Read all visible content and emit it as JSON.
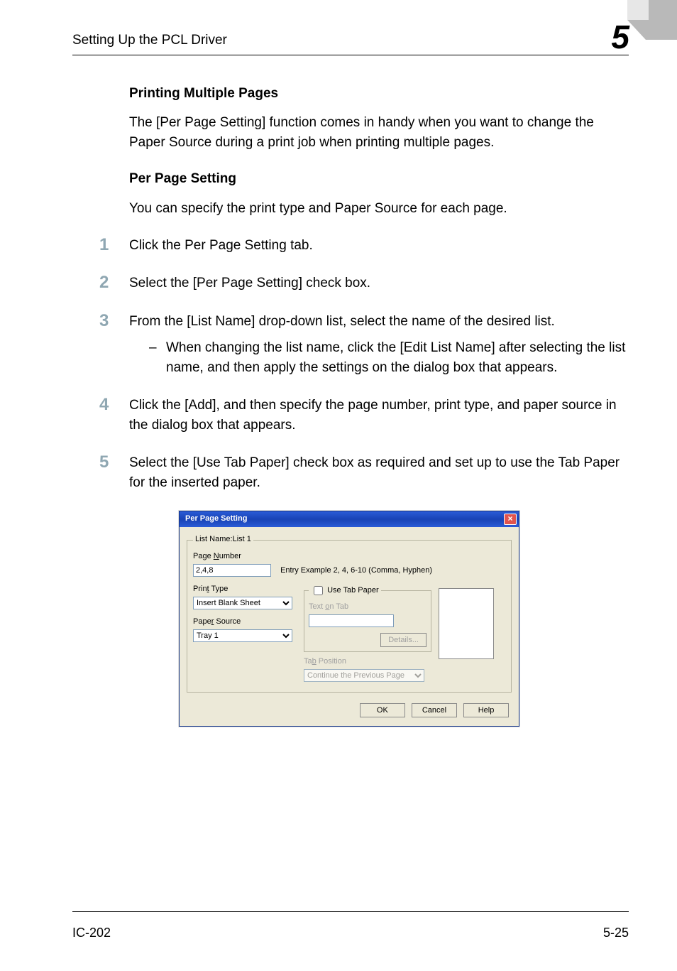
{
  "header": {
    "left": "Setting Up the PCL Driver",
    "chapter": "5"
  },
  "sections": {
    "title1": "Printing Multiple Pages",
    "para1": "The [Per Page Setting] function comes in handy when you want to change the Paper Source during a print job when printing multiple pages.",
    "title2": "Per Page Setting",
    "para2": "You can specify the print type and Paper Source for each page."
  },
  "steps": {
    "s1": {
      "n": "1",
      "t": "Click the Per Page Setting tab."
    },
    "s2": {
      "n": "2",
      "t": "Select the [Per Page Setting] check box."
    },
    "s3": {
      "n": "3",
      "t": "From the [List Name] drop-down list, select the name of the desired list.",
      "sub1": "When changing the list name, click the [Edit List Name] after selecting the list name, and then apply the settings on the dialog box that appears."
    },
    "s4": {
      "n": "4",
      "t": "Click the [Add], and then specify the page number, print type, and paper source in the dialog box that appears."
    },
    "s5": {
      "n": "5",
      "t": "Select the [Use Tab Paper] check box as required and set up to use the Tab Paper for the inserted paper."
    }
  },
  "dialog": {
    "title": "Per Page Setting",
    "group_legend": "List Name:List 1",
    "page_number_label_pre": "Page ",
    "page_number_label_ul": "N",
    "page_number_label_post": "umber",
    "page_number_value": "2,4,8",
    "entry_hint": "Entry Example 2, 4, 6-10 (Comma, Hyphen)",
    "print_type_label_pre": "Prin",
    "print_type_label_ul": "t",
    "print_type_label_post": " Type",
    "print_type_value": "Insert Blank Sheet",
    "paper_source_label_pre": "Pape",
    "paper_source_label_ul": "r",
    "paper_source_label_post": " Source",
    "paper_source_value": "Tray 1",
    "use_tab_label_ul": "U",
    "use_tab_label_post": "se Tab Paper",
    "text_on_tab_label_pre": "Text ",
    "text_on_tab_label_ul": "o",
    "text_on_tab_label_post": "n Tab",
    "text_on_tab_value": "",
    "details_btn_ul": "D",
    "details_btn_post": "etails...",
    "tab_position_label_pre": "Ta",
    "tab_position_label_ul": "b",
    "tab_position_label_post": " Position",
    "tab_position_value": "Continue the Previous Page",
    "ok": "OK",
    "cancel": "Cancel",
    "help": "Help"
  },
  "footer": {
    "left": "IC-202",
    "right": "5-25"
  }
}
